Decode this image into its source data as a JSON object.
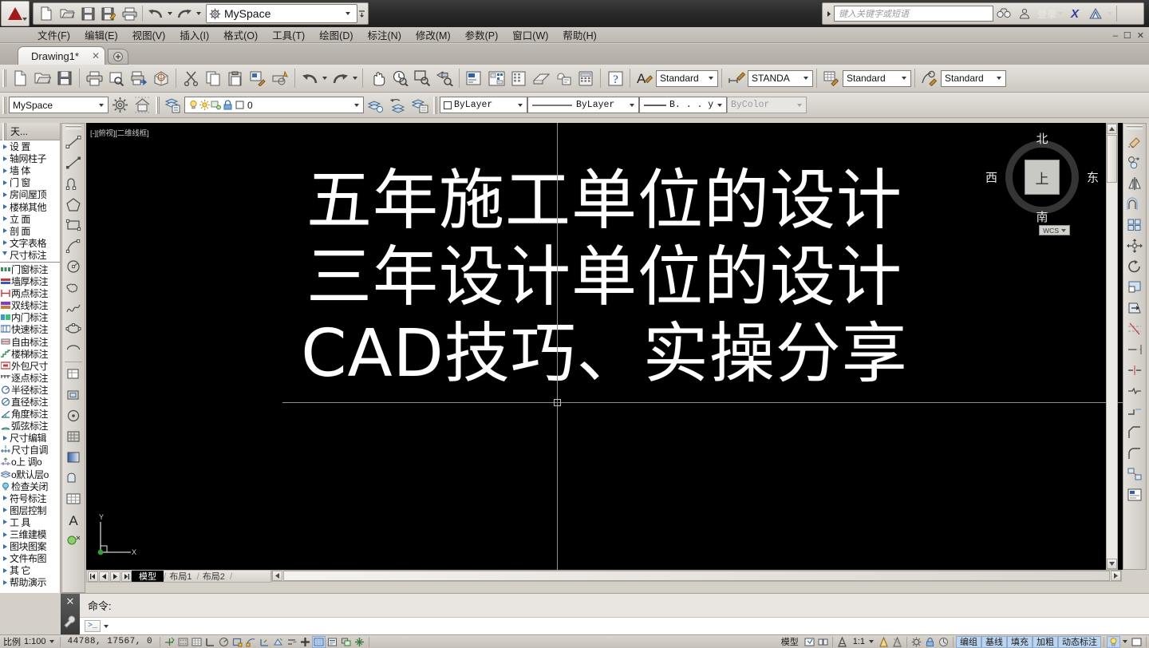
{
  "app": {
    "workspace": "MySpace",
    "search_placeholder": "键入关键字或短语",
    "signin_label": "登录",
    "x_badge": "X"
  },
  "menubar": [
    {
      "label": "文件(F)"
    },
    {
      "label": "编辑(E)"
    },
    {
      "label": "视图(V)"
    },
    {
      "label": "插入(I)"
    },
    {
      "label": "格式(O)"
    },
    {
      "label": "工具(T)"
    },
    {
      "label": "绘图(D)"
    },
    {
      "label": "标注(N)"
    },
    {
      "label": "修改(M)"
    },
    {
      "label": "参数(P)"
    },
    {
      "label": "窗口(W)"
    },
    {
      "label": "帮助(H)"
    }
  ],
  "doctab": {
    "title": "Drawing1*",
    "close": "✕"
  },
  "toolbar_styles": [
    {
      "name": "text-style",
      "value": "Standard"
    },
    {
      "name": "dim-style",
      "value": "STANDA"
    },
    {
      "name": "table-style",
      "value": "Standard"
    },
    {
      "name": "mleader-style",
      "value": "Standard"
    }
  ],
  "toolbar2": {
    "workspace_value": "MySpace",
    "layer_value": "0",
    "layer_color_value": "ByLayer",
    "linetype_value": "ByLayer",
    "lineweight_value": "B. . . ye",
    "plotstyle_value": "ByColor"
  },
  "palette": {
    "title": "天...",
    "groups": [
      {
        "label": "设        置"
      },
      {
        "label": "轴网柱子"
      },
      {
        "label": "墙       体"
      },
      {
        "label": "门       窗"
      },
      {
        "label": "房间屋顶"
      },
      {
        "label": "楼梯其他"
      },
      {
        "label": "立       面"
      },
      {
        "label": "剖       面"
      },
      {
        "label": "文字表格"
      },
      {
        "label": "尺寸标注",
        "open": true
      }
    ],
    "items": [
      {
        "label": "门窗标注"
      },
      {
        "label": "墙厚标注"
      },
      {
        "label": "两点标注"
      },
      {
        "label": "双线标注"
      },
      {
        "label": "内门标注"
      },
      {
        "label": "快速标注"
      },
      {
        "label": "自由标注"
      },
      {
        "label": "楼梯标注"
      },
      {
        "label": "外包尺寸"
      },
      {
        "label": "逐点标注"
      },
      {
        "label": "半径标注"
      },
      {
        "label": "直径标注"
      },
      {
        "label": "角度标注"
      },
      {
        "label": "弧弦标注"
      }
    ],
    "subgroups": [
      {
        "label": "尺寸编辑",
        "arrow": true
      },
      {
        "label": "尺寸自调",
        "arrow": false
      },
      {
        "label": "o上    调o",
        "arrow": false
      },
      {
        "label": "o默认层o",
        "arrow": false
      },
      {
        "label": "检查关闭",
        "arrow": false
      },
      {
        "label": "符号标注",
        "arrow": true
      },
      {
        "label": "图层控制",
        "arrow": true
      },
      {
        "label": "工       具",
        "arrow": true
      },
      {
        "label": "三维建模",
        "arrow": true
      },
      {
        "label": "图块图案",
        "arrow": true
      },
      {
        "label": "文件布图",
        "arrow": true
      },
      {
        "label": "其       它",
        "arrow": true
      },
      {
        "label": "帮助演示",
        "arrow": true
      }
    ]
  },
  "canvas": {
    "viewport_label": "[-][俯视][二维线框]",
    "text_lines": [
      "五年施工单位的设计",
      "三年设计单位的设计",
      "CAD技巧、实操分享"
    ],
    "viewcube": {
      "north": "北",
      "south": "南",
      "west": "西",
      "east": "东",
      "top_face": "上",
      "wcs_label": "WCS"
    },
    "ucs": {
      "x_label": "X",
      "y_label": "Y"
    }
  },
  "layout_tabs": [
    {
      "label": "模型",
      "active": true
    },
    {
      "label": "布局1",
      "active": false
    },
    {
      "label": "布局2",
      "active": false
    }
  ],
  "command": {
    "history": "命令:",
    "prompt": ">_",
    "input_value": ""
  },
  "statusbar": {
    "scale_label": "比例",
    "scale_value": "1:100",
    "coordinates": "44788,  17567,  0",
    "model_label": "模型",
    "annot_scale": "1:1",
    "toggles": [
      {
        "label": "编组",
        "on": true
      },
      {
        "label": "基线",
        "on": true
      },
      {
        "label": "填充",
        "on": true
      },
      {
        "label": "加粗",
        "on": true
      },
      {
        "label": "动态标注",
        "on": true
      }
    ]
  },
  "colors": {
    "canvas_bg": "#000000",
    "canvas_text": "#ffffff",
    "accent": "#8aa8d0",
    "chrome": "#d4d0c8",
    "titlebar": "#2b2b2b"
  }
}
